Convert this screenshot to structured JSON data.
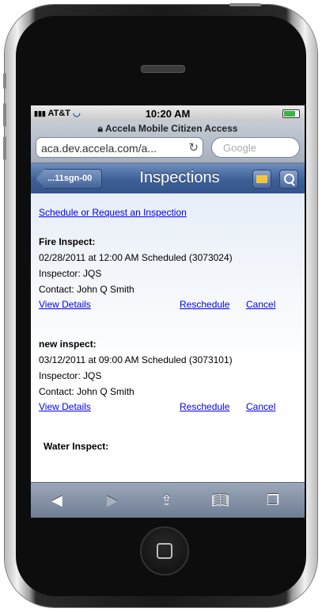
{
  "status_bar": {
    "carrier": "AT&T",
    "time": "10:20 AM"
  },
  "browser": {
    "page_title": "Accela Mobile Citizen Access",
    "address": "aca.dev.accela.com/a...",
    "search_placeholder": "Google"
  },
  "navbar": {
    "back_label": "...11sgn-00",
    "title": "Inspections"
  },
  "content": {
    "schedule_link": "Schedule or Request an Inspection",
    "inspections": [
      {
        "name": "Fire Inspect:",
        "schedule": "02/28/2011 at 12:00 AM Scheduled (3073024)",
        "inspector": "Inspector: JQS",
        "contact": "Contact: John Q Smith",
        "view_details": "View Details",
        "reschedule": "Reschedule",
        "cancel": "Cancel"
      },
      {
        "name": "new inspect:",
        "schedule": "03/12/2011 at 09:00 AM Scheduled (3073101)",
        "inspector": "Inspector: JQS",
        "contact": "Contact: John Q Smith",
        "view_details": "View Details",
        "reschedule": "Reschedule",
        "cancel": "Cancel"
      },
      {
        "name": "Water Inspect:"
      }
    ]
  },
  "toolbar": {
    "icons": [
      "back-arrow-icon",
      "forward-arrow-icon",
      "share-icon",
      "bookmarks-icon",
      "pages-icon"
    ]
  },
  "colors": {
    "navbar": "#3d5f96",
    "link": "#0000ee"
  }
}
